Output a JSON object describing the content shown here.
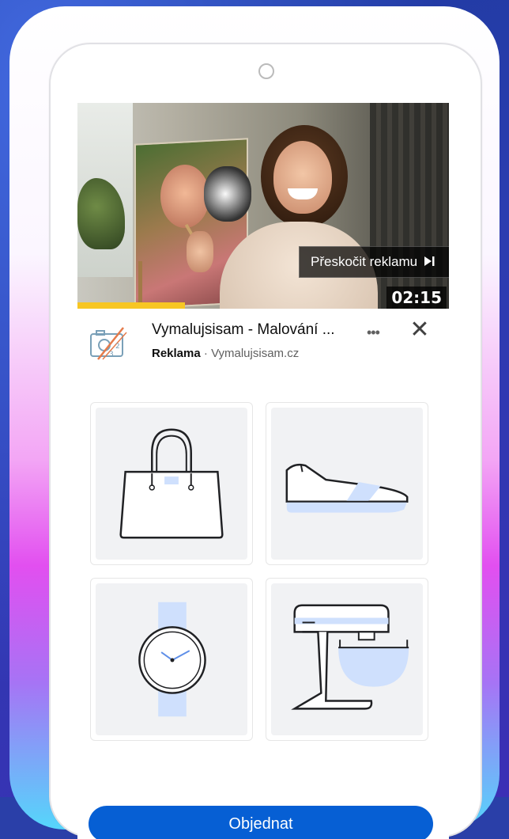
{
  "video": {
    "skip_label": "Přeskočit reklamu",
    "skip_icon": "skip-next-icon",
    "timer": "02:15",
    "progress_fraction": 0.29
  },
  "ad": {
    "title": "Vymalujsisam - Malování ...",
    "sponsored_label": "Reklama",
    "separator": " · ",
    "domain": "Vymalujsisam.cz",
    "more_icon": "•••",
    "close_icon": "✕"
  },
  "products": [
    {
      "name": "handbag"
    },
    {
      "name": "sneaker"
    },
    {
      "name": "wristwatch"
    },
    {
      "name": "stand-mixer"
    }
  ],
  "cta": {
    "label": "Objednat"
  },
  "colors": {
    "accent_blue": "#065fd4",
    "product_highlight": "#cfe0fd",
    "progress_yellow": "#f7c623"
  }
}
